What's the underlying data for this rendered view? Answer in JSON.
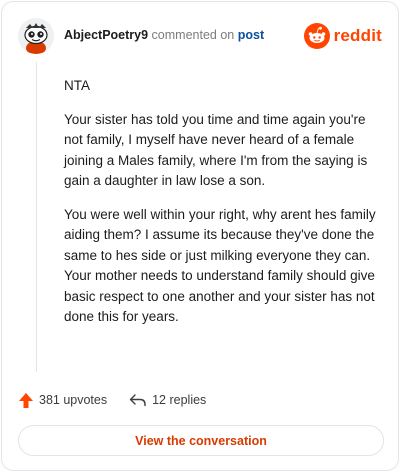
{
  "comment": {
    "username": "AbjectPoetry9",
    "action_text": "commented on",
    "post_link": "post",
    "paragraphs": [
      "NTA",
      "Your sister has told you time and time again you're not family, I myself have never heard of a female joining a Males family, where I'm from the saying is gain a daughter in law lose a son.",
      "You were well within your right, why arent hes family aiding them? I assume its because they've done the same to hes side or just milking everyone they can. Your mother needs to understand family should give basic respect to one another and your sister has not done this for years."
    ]
  },
  "brand": {
    "name": "reddit",
    "color": "#ff4500"
  },
  "stats": {
    "upvotes": "381 upvotes",
    "replies": "12 replies"
  },
  "cta": {
    "label": "View the conversation"
  },
  "icons": {
    "avatar": "snoo-avatar-icon",
    "upvote": "upvote-arrow-icon",
    "reply": "reply-arrow-icon",
    "logo": "reddit-snoo-icon"
  }
}
